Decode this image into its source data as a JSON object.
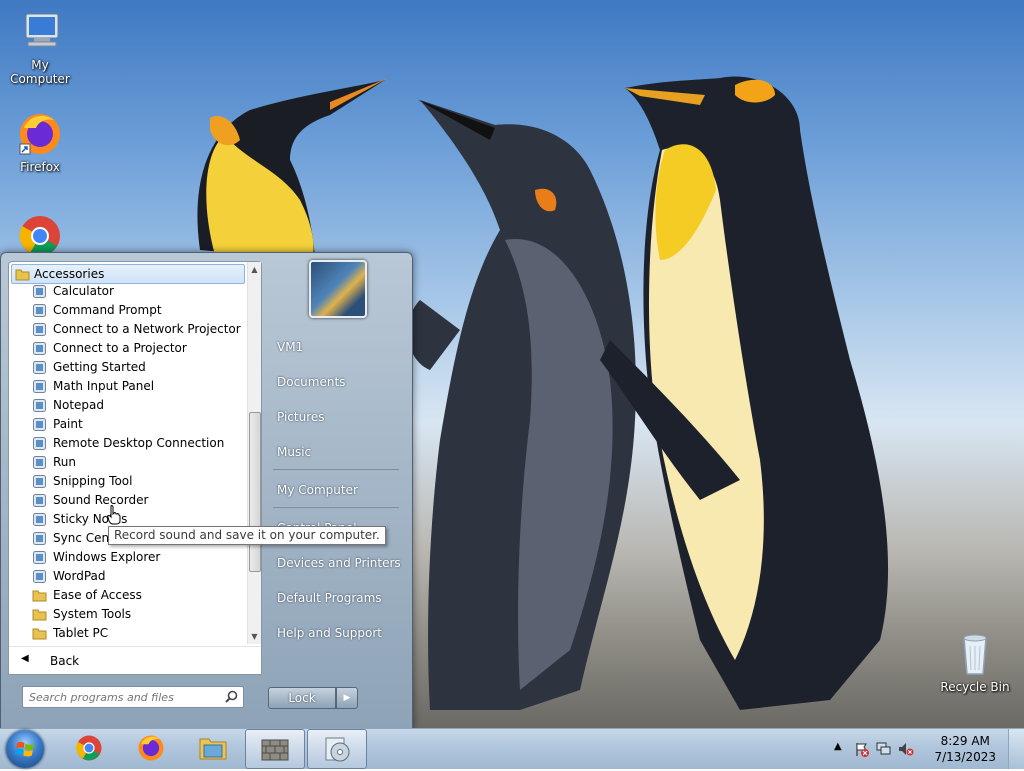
{
  "desktop": {
    "icons": [
      {
        "label": "My Computer",
        "icon": "computer-icon"
      },
      {
        "label": "Firefox",
        "icon": "firefox-icon"
      },
      {
        "label": "",
        "icon": "chrome-icon"
      },
      {
        "label": "Recycle Bin",
        "icon": "recycle-bin-icon"
      }
    ],
    "wallpaper": "king-penguins"
  },
  "startmenu": {
    "folder": "Accessories",
    "programs": [
      {
        "label": "Calculator",
        "icon": "calculator-icon"
      },
      {
        "label": "Command Prompt",
        "icon": "command-prompt-icon"
      },
      {
        "label": "Connect to a Network Projector",
        "icon": "network-projector-icon"
      },
      {
        "label": "Connect to a Projector",
        "icon": "projector-icon"
      },
      {
        "label": "Getting Started",
        "icon": "getting-started-icon"
      },
      {
        "label": "Math Input Panel",
        "icon": "math-input-icon"
      },
      {
        "label": "Notepad",
        "icon": "notepad-icon"
      },
      {
        "label": "Paint",
        "icon": "paint-icon"
      },
      {
        "label": "Remote Desktop Connection",
        "icon": "remote-desktop-icon"
      },
      {
        "label": "Run",
        "icon": "run-icon"
      },
      {
        "label": "Snipping Tool",
        "icon": "snipping-tool-icon"
      },
      {
        "label": "Sound Recorder",
        "icon": "microphone-icon"
      },
      {
        "label": "Sticky Notes",
        "icon": "sticky-notes-icon"
      },
      {
        "label": "Sync Center",
        "icon": "sync-icon"
      },
      {
        "label": "Windows Explorer",
        "icon": "explorer-icon"
      },
      {
        "label": "WordPad",
        "icon": "wordpad-icon"
      },
      {
        "label": "Ease of Access",
        "icon": "folder-icon"
      },
      {
        "label": "System Tools",
        "icon": "folder-icon"
      },
      {
        "label": "Tablet PC",
        "icon": "folder-icon"
      }
    ],
    "back_label": "Back",
    "search_placeholder": "Search programs and files",
    "right_links": [
      "VM1",
      "Documents",
      "Pictures",
      "Music",
      "My Computer",
      "Control Panel",
      "Devices and Printers",
      "Default Programs",
      "Help and Support"
    ],
    "lock_label": "Lock",
    "tooltip": "Record sound and save it on your computer."
  },
  "taskbar": {
    "pinned": [
      "chrome",
      "firefox",
      "file-explorer",
      "firewall",
      "setup"
    ],
    "clock_time": "8:29 AM",
    "clock_date": "7/13/2023"
  }
}
